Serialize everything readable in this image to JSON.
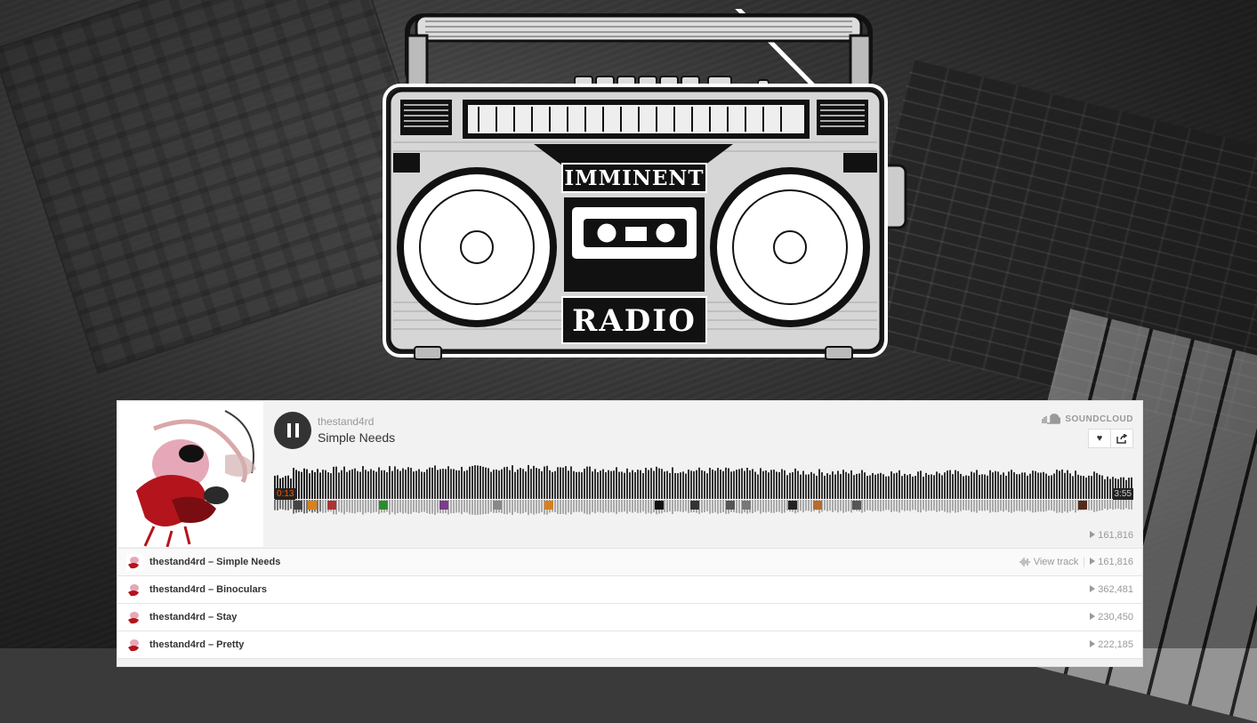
{
  "logo": {
    "top_text": "IMMINENT",
    "bottom_text": "RADIO"
  },
  "player": {
    "artist": "thestand4rd",
    "title": "Simple Needs",
    "brand": "SOUNDCLOUD",
    "current_time": "0:13",
    "duration": "3:55",
    "progress": 0.055,
    "plays": "161,816",
    "like_icon": "heart-icon",
    "share_icon": "share-icon"
  },
  "tracks": [
    {
      "name": "thestand4rd – Simple Needs",
      "plays": "161,816",
      "view_label": "View track"
    },
    {
      "name": "thestand4rd – Binoculars",
      "plays": "362,481"
    },
    {
      "name": "thestand4rd – Stay",
      "plays": "230,450"
    },
    {
      "name": "thestand4rd – Pretty",
      "plays": "222,185"
    }
  ]
}
